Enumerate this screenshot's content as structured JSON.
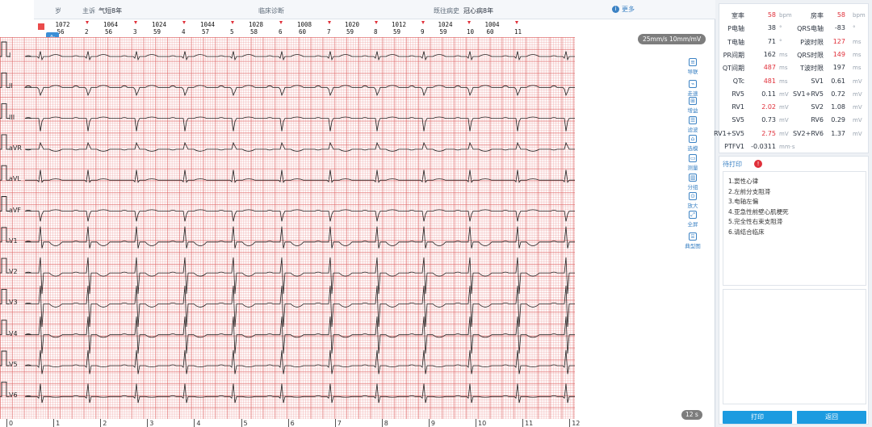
{
  "info_bar": {
    "fragment": "岁",
    "chief_label": "主诉",
    "chief_value": "气短8年",
    "diag_label": "临床诊断",
    "history_label": "既往病史",
    "history_value": "冠心病8年",
    "more_label": "更多",
    "more_icon": "info-icon"
  },
  "rhythm": {
    "rr_intervals": [
      "1072",
      "1064",
      "1024",
      "1044",
      "1028",
      "1008",
      "1020",
      "1012",
      "1024",
      "1004"
    ],
    "heart_rates": [
      "56",
      "56",
      "59",
      "57",
      "58",
      "60",
      "59",
      "59",
      "59",
      "60"
    ],
    "beat_numbers": [
      "2",
      "3",
      "4",
      "5",
      "6",
      "7",
      "8",
      "9",
      "10",
      "11"
    ]
  },
  "display": {
    "speed_gain": "25mm/s 10mm/mV",
    "duration": "12 s"
  },
  "leads": [
    "I",
    "II",
    "III",
    "aVR",
    "aVL",
    "aVF",
    "V1",
    "V2",
    "V3",
    "V4",
    "V5",
    "V6"
  ],
  "time_axis": [
    "0",
    "1",
    "2",
    "3",
    "4",
    "5",
    "6",
    "7",
    "8",
    "9",
    "10",
    "11",
    "12"
  ],
  "toolbar": [
    {
      "label": "导联",
      "icon": "lead-icon"
    },
    {
      "label": "走速",
      "icon": "speed-icon"
    },
    {
      "label": "增益",
      "icon": "gain-icon"
    },
    {
      "label": "滤波",
      "icon": "filter-icon"
    },
    {
      "label": "选模",
      "icon": "template-icon"
    },
    {
      "label": "测量",
      "icon": "ruler-icon"
    },
    {
      "label": "分组",
      "icon": "group-icon"
    },
    {
      "label": "放大",
      "icon": "zoom-icon"
    },
    {
      "label": "全屏",
      "icon": "fullscreen-icon"
    },
    {
      "label": "典型图",
      "icon": "typical-chart-icon"
    }
  ],
  "measurements": [
    {
      "k1": "室率",
      "v1": "58",
      "u1": "bpm",
      "r1": true,
      "k2": "房率",
      "v2": "58",
      "u2": "bpm",
      "r2": true
    },
    {
      "k1": "P电轴",
      "v1": "38",
      "u1": "°",
      "r1": false,
      "k2": "QRS电轴",
      "v2": "-83",
      "u2": "°",
      "r2": false
    },
    {
      "k1": "T电轴",
      "v1": "71",
      "u1": "°",
      "r1": false,
      "k2": "P波时限",
      "v2": "127",
      "u2": "ms",
      "r2": true
    },
    {
      "k1": "PR间期",
      "v1": "162",
      "u1": "ms",
      "r1": false,
      "k2": "QRS时限",
      "v2": "149",
      "u2": "ms",
      "r2": true
    },
    {
      "k1": "QT间期",
      "v1": "487",
      "u1": "ms",
      "r1": true,
      "k2": "T波时限",
      "v2": "197",
      "u2": "ms",
      "r2": false
    },
    {
      "k1": "QTc",
      "v1": "481",
      "u1": "ms",
      "r1": true,
      "k2": "SV1",
      "v2": "0.61",
      "u2": "mV",
      "r2": false
    },
    {
      "k1": "RV5",
      "v1": "0.11",
      "u1": "mV",
      "r1": false,
      "k2": "SV1+RV5",
      "v2": "0.72",
      "u2": "mV",
      "r2": false
    },
    {
      "k1": "RV1",
      "v1": "2.02",
      "u1": "mV",
      "r1": true,
      "k2": "SV2",
      "v2": "1.08",
      "u2": "mV",
      "r2": false
    },
    {
      "k1": "SV5",
      "v1": "0.73",
      "u1": "mV",
      "r1": false,
      "k2": "RV6",
      "v2": "0.29",
      "u2": "mV",
      "r2": false
    },
    {
      "k1": "RV1+SV5",
      "v1": "2.75",
      "u1": "mV",
      "r1": true,
      "k2": "SV2+RV6",
      "v2": "1.37",
      "u2": "mV",
      "r2": false
    },
    {
      "k1": "PTFV1",
      "v1": "-0.0311",
      "u1": "mm·s",
      "r1": false,
      "k2": "",
      "v2": "",
      "u2": "",
      "r2": false
    }
  ],
  "report": {
    "title": "待打印",
    "alert_icon": "alert-icon",
    "lines": [
      "1.窦性心律",
      "2.左前分支阻滞",
      "3.电轴左偏",
      "4.亚急性前壁心肌梗死",
      "5.完全性右束支阻滞",
      "6.请结合临床"
    ],
    "print_label": "打印",
    "back_label": "返回"
  },
  "colors": {
    "accent": "#1c9be0",
    "alert": "#e0303a",
    "grid": "#dc6060"
  }
}
